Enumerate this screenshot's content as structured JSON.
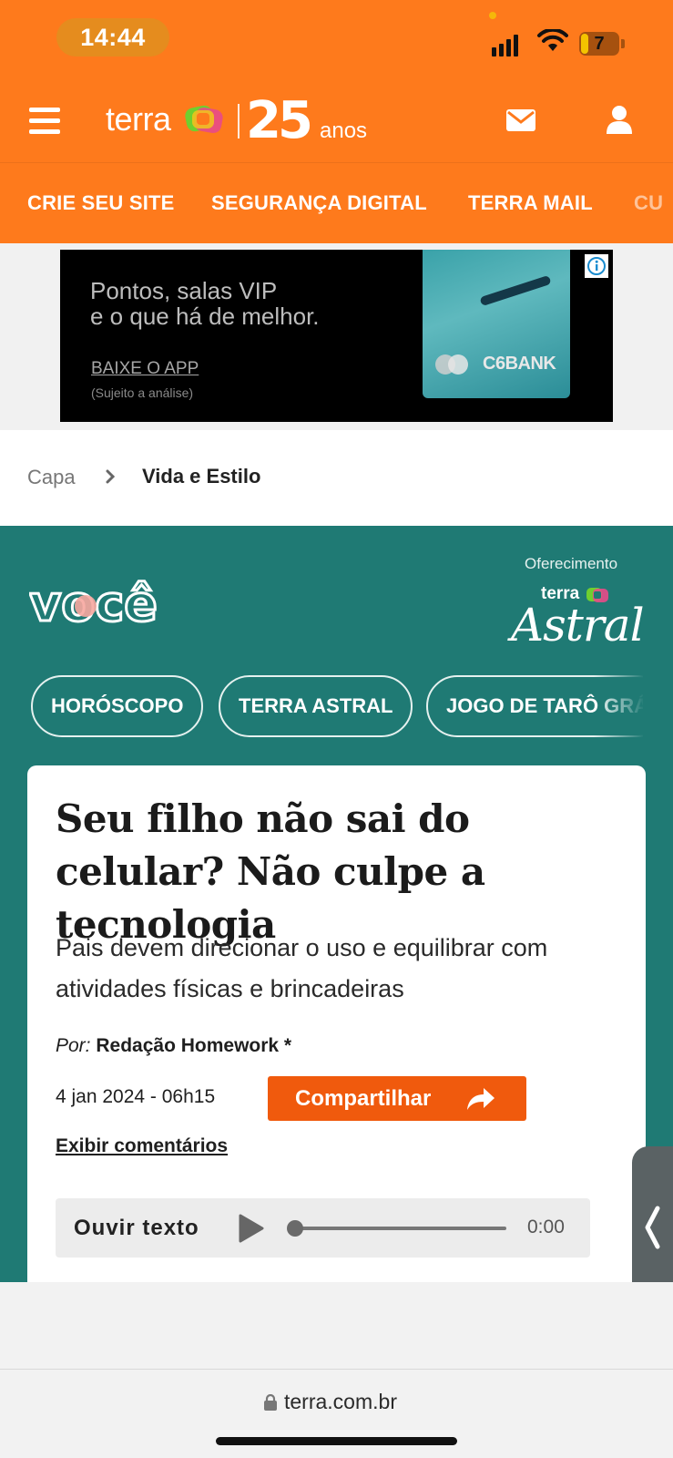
{
  "status_bar": {
    "time": "14:44",
    "battery": "7",
    "icons": [
      "cellular-signal-icon",
      "wifi-icon",
      "battery-icon"
    ]
  },
  "header": {
    "logo_text": "terra",
    "anniversary_number": "25",
    "anniversary_word": "anos",
    "icons": [
      "menu-icon",
      "mail-icon",
      "user-icon"
    ]
  },
  "nav": {
    "items": [
      "CRIE SEU SITE",
      "SEGURANÇA DIGITAL",
      "TERRA MAIL",
      "CU"
    ]
  },
  "ad": {
    "line1": "Pontos, salas VIP",
    "line2": "e o que há de melhor.",
    "cta": "BAIXE O APP",
    "note": "(Sujeito a análise)",
    "brand": "C6BANK",
    "info_icon": "info-icon"
  },
  "breadcrumb": {
    "home": "Capa",
    "current": "Vida e Estilo"
  },
  "section": {
    "logo": "você",
    "sponsor_label": "Oferecimento",
    "sponsor_brand": "terra",
    "sponsor_name": "Astral",
    "chips": [
      "HORÓSCOPO",
      "TERRA ASTRAL",
      "JOGO DE TARÔ GRÁ"
    ],
    "background": "#1f7a74"
  },
  "article": {
    "headline": "Seu filho não sai do celular? Não culpe a tecnologia",
    "subhead": "Pais devem direcionar o uso e equilibrar com atividades físicas e brincadeiras",
    "byline_label": "Por:",
    "byline_name": "Redação Homework *",
    "date": "4 jan 2024 - 06h15",
    "share_label": "Compartilhar",
    "comments_link": "Exibir comentários",
    "audio": {
      "label": "Ouvir texto",
      "time": "0:00",
      "progress": 0
    }
  },
  "browser": {
    "url": "terra.com.br"
  },
  "colors": {
    "brand_orange": "#fe7a1c",
    "share_orange": "#f05a0d",
    "teal": "#1f7a74"
  }
}
